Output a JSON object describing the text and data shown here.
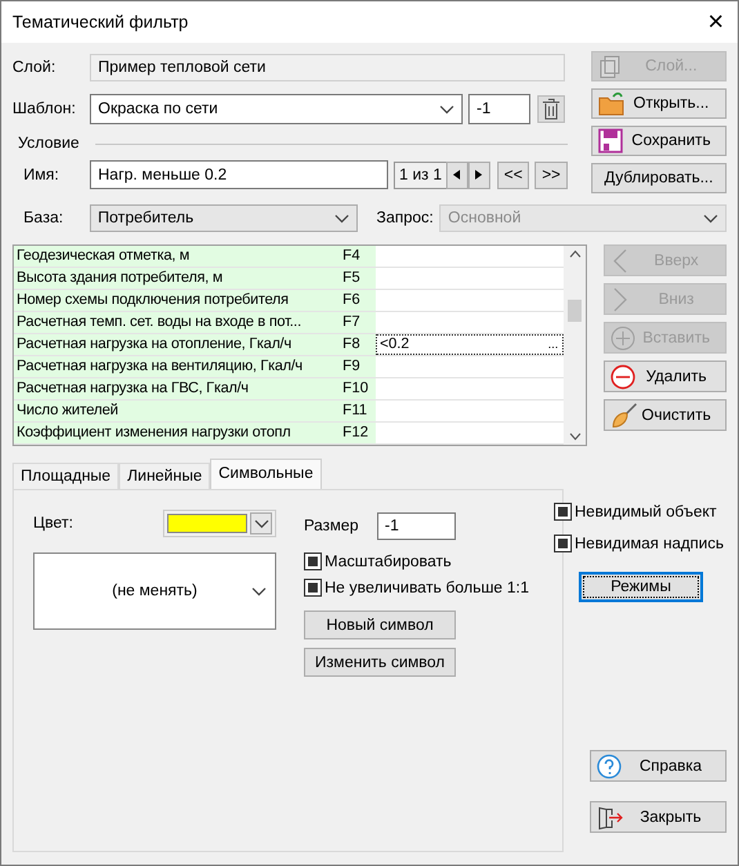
{
  "window": {
    "title": "Тематический фильтр",
    "close": "×"
  },
  "layer": {
    "label": "Слой:",
    "value": "Пример тепловой сети"
  },
  "template": {
    "label": "Шаблон:",
    "value": "Окраска по сети",
    "number": "-1"
  },
  "condition": {
    "label": "Условие"
  },
  "name": {
    "label": "Имя:",
    "value": "Нагр. меньше 0.2",
    "counter": "1 из 1",
    "first": "<<",
    "last": ">>"
  },
  "base": {
    "label": "База:",
    "value": "Потребитель"
  },
  "query": {
    "label": "Запрос:",
    "value": "Основной",
    "disabled": true
  },
  "top_buttons": [
    {
      "label": "Слой...",
      "kind": "layer",
      "disabled": true
    },
    {
      "label": "Открыть...",
      "kind": "open",
      "disabled": false
    },
    {
      "label": "Сохранить",
      "kind": "save",
      "disabled": false
    },
    {
      "label": "Дублировать...",
      "kind": "plain",
      "disabled": false
    }
  ],
  "table": {
    "editor_button": "...",
    "rows": [
      {
        "name": "Геодезическая отметка, м",
        "field": "F4",
        "value": "",
        "selected": false
      },
      {
        "name": "Высота здания потребителя, м",
        "field": "F5",
        "value": "",
        "selected": false
      },
      {
        "name": "Номер схемы подключения потребителя",
        "field": "F6",
        "value": "",
        "selected": false
      },
      {
        "name": "Расчетная темп. сет. воды на входе в пот...",
        "field": "F7",
        "value": "",
        "selected": false
      },
      {
        "name": "Расчетная нагрузка на отопление, Гкал/ч",
        "field": "F8",
        "value": "<0.2",
        "selected": true
      },
      {
        "name": "Расчетная нагрузка на вентиляцию, Гкал/ч",
        "field": "F9",
        "value": "",
        "selected": false
      },
      {
        "name": "Расчетная нагрузка на ГВС, Гкал/ч",
        "field": "F10",
        "value": "",
        "selected": false
      },
      {
        "name": "Число жителей",
        "field": "F11",
        "value": "",
        "selected": false
      },
      {
        "name": "Коэффициент изменения нагрузки отопл",
        "field": "F12",
        "value": "",
        "selected": false
      }
    ]
  },
  "row_buttons": [
    {
      "label": "Вверх",
      "kind": "left",
      "disabled": true
    },
    {
      "label": "Вниз",
      "kind": "right",
      "disabled": true
    },
    {
      "label": "Вставить",
      "kind": "plus",
      "disabled": true
    },
    {
      "label": "Удалить",
      "kind": "minus",
      "disabled": false
    },
    {
      "label": "Очистить",
      "kind": "brush",
      "disabled": false
    }
  ],
  "tabs": [
    {
      "label": "Площадные",
      "selected": false
    },
    {
      "label": "Линейные",
      "selected": false
    },
    {
      "label": "Символьные",
      "selected": true
    }
  ],
  "symbol": {
    "color_label": "Цвет:",
    "color": "#ffff00",
    "symbol_value": "(не менять)",
    "size_label": "Размер",
    "size": "-1",
    "options": [
      {
        "label": "Масштабировать",
        "checked": true
      },
      {
        "label": "Не увеличивать больше 1:1",
        "checked": true
      }
    ],
    "buttons": [
      "Новый символ",
      "Изменить символ"
    ]
  },
  "flags": [
    {
      "label": "Невидимый объект",
      "checked": true
    },
    {
      "label": "Невидимая надпись",
      "checked": true
    }
  ],
  "modes_button": "Режимы",
  "bottom_buttons": [
    {
      "label": "Справка",
      "kind": "help"
    },
    {
      "label": "Закрыть",
      "kind": "exit"
    }
  ]
}
